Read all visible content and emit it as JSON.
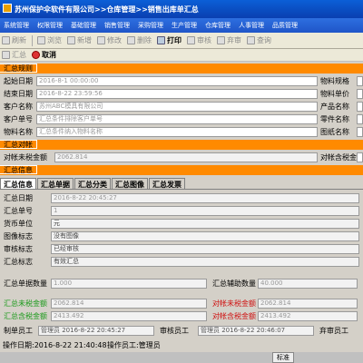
{
  "window": {
    "title": "苏州保护伞软件有限公司>>仓库管理>>销售出库单汇总"
  },
  "menu": [
    "系统管理",
    "权限管理",
    "基础管理",
    "销售管理",
    "采购管理",
    "生产管理",
    "仓库管理",
    "人事管理",
    "品质管理"
  ],
  "toolbar": [
    {
      "icon": "refresh-icon",
      "label": "刷新"
    },
    {
      "icon": "browse-icon",
      "label": "浏览"
    },
    {
      "icon": "add-icon",
      "label": "新增"
    },
    {
      "icon": "edit-icon",
      "label": "修改"
    },
    {
      "icon": "delete-icon",
      "label": "删除"
    },
    {
      "icon": "print-icon",
      "label": "打印"
    },
    {
      "icon": "audit-icon",
      "label": "审核"
    },
    {
      "icon": "abandon-icon",
      "label": "弃审"
    },
    {
      "icon": "query-icon",
      "label": "查询"
    }
  ],
  "toolbar2": [
    {
      "icon": "summary-icon",
      "label": "汇总"
    },
    {
      "icon": "cancel-icon",
      "label": "取消"
    }
  ],
  "rules": {
    "header": "汇总规则",
    "start_label": "起始日期",
    "start_value": "2016-8-1 00:00:00",
    "end_label": "结束日期",
    "end_value": "2016-8-22 23:59:56",
    "customer_name_label": "客户名称",
    "customer_name_value": "苏州ABC模具有限公司",
    "customer_no_label": "客户单号",
    "customer_no_value": "汇总条件排除客户单号",
    "material_label": "物料名称",
    "material_value": "汇总条件纳入物料名称",
    "right": [
      "物料规格",
      "物料单价",
      "产品名称",
      "零件名称",
      "图纸名称"
    ]
  },
  "reconcile": {
    "header": "汇总对帐",
    "label": "对帐未税金额",
    "value": "2062.814",
    "right_label": "对帐含税金额"
  },
  "info": {
    "header": "汇总信息",
    "tabs": [
      "汇总信息",
      "汇总单据",
      "汇总分类",
      "汇总图像",
      "汇总发票"
    ],
    "date_label": "汇总日期",
    "date_value": "2016-8-22 20:45:27",
    "no_label": "汇总单号",
    "no_value": "1",
    "currency_label": "货币单位",
    "currency_value": "元",
    "image_label": "图像标志",
    "image_value": "没有图像",
    "audit_label": "审核标志",
    "audit_value": "已经审核",
    "sum_flag_label": "汇总标志",
    "sum_flag_value": "有效汇总",
    "qty_label": "汇总单据数量",
    "qty_value": "1.000",
    "aux_label": "汇总辅助数量",
    "aux_value": "40.000",
    "untaxed_label": "汇总未税金额",
    "untaxed_value": "2062.814",
    "recon_untaxed_label": "对帐未税金额",
    "recon_untaxed_value": "2062.814",
    "taxed_label": "汇总含税金额",
    "taxed_value": "2413.492",
    "recon_taxed_label": "对帐含税金额",
    "recon_taxed_value": "2413.492"
  },
  "status": {
    "maker_label": "制单员工",
    "maker_value": "管理员 2016-8-22 20:45:27",
    "auditor_label": "审核员工",
    "auditor_value": "管理员 2016-8-22 20:46:07",
    "abandon_label": "弃审员工",
    "op_date": "操作日期:2016-8-22 21:40:48",
    "operator": "操作员工:管理员"
  },
  "taskbar": {
    "mode": "标准"
  },
  "colors": {
    "section": "#ff8a00",
    "title": "#0b5fd7"
  }
}
